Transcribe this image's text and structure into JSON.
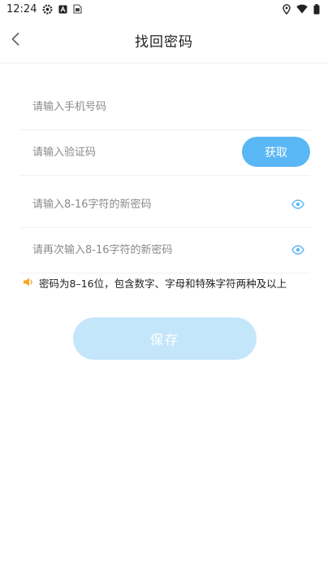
{
  "status_bar": {
    "time": "12:24",
    "left_icons": [
      "settings-gear-icon",
      "a-square-icon",
      "sim-icon"
    ],
    "right_icons": [
      "location-icon",
      "wifi-icon",
      "battery-icon"
    ]
  },
  "header": {
    "title": "找回密码",
    "back_icon": "chevron-left-icon"
  },
  "form": {
    "phone_placeholder": "请输入手机号码",
    "code_placeholder": "请输入验证码",
    "get_code_label": "获取",
    "new_password_placeholder": "请输入8-16字符的新密码",
    "confirm_password_placeholder": "请再次输入8-16字符的新密码"
  },
  "hint": {
    "text": "密码为8–16位，包含数字、字母和特殊字符两种及以上",
    "icon": "speaker-icon"
  },
  "save_label": "保存",
  "colors": {
    "accent": "#5ab7f5",
    "save_disabled": "#c4e6fb",
    "eye": "#5ab7f5",
    "speaker": "#f5a623"
  }
}
